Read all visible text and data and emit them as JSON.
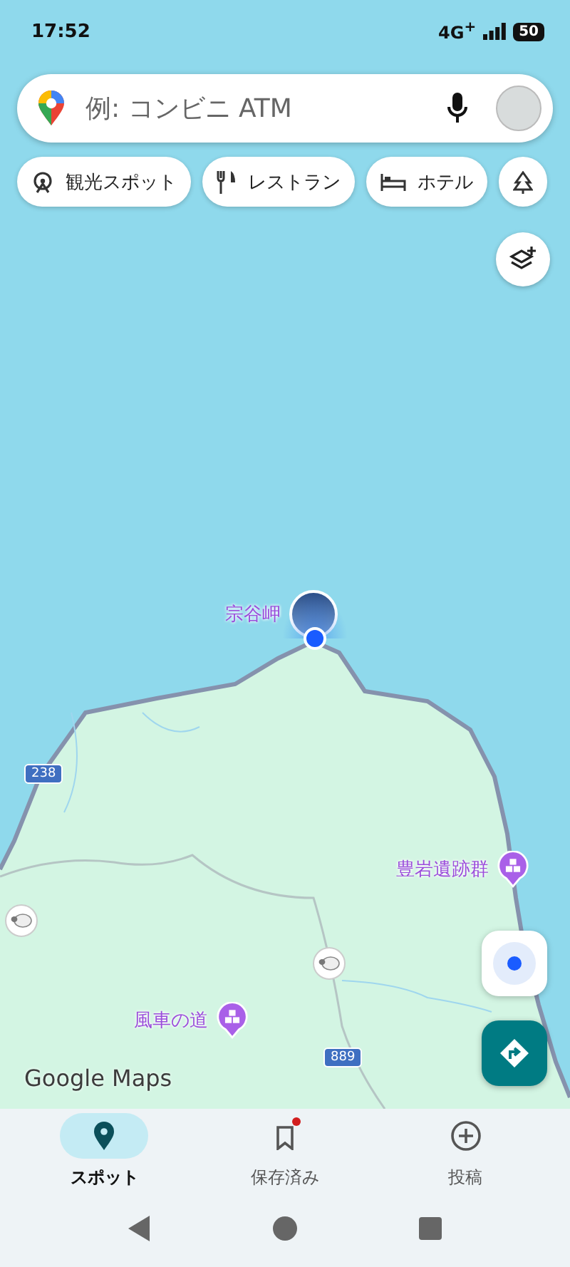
{
  "status_bar": {
    "time": "17:52",
    "network": "4G$^{+}$",
    "battery": "50"
  },
  "search": {
    "placeholder": "例: コンビニ ATM"
  },
  "chips": [
    "観光スポット",
    "レストラン",
    "ホテル"
  ],
  "map": {
    "places": [
      {
        "kind": "photo",
        "label": "宗谷岬"
      },
      {
        "kind": "landmark",
        "label": "豊岩遺跡群"
      },
      {
        "kind": "landmark",
        "label": "風車の道"
      },
      {
        "kind": "sheep"
      },
      {
        "kind": "sheep"
      }
    ],
    "routes": [
      "238",
      "889"
    ],
    "logo": "Google Maps"
  },
  "nav": [
    {
      "label": "スポット",
      "selected": true,
      "dot": false
    },
    {
      "label": "保存済み",
      "selected": false,
      "dot": true
    },
    {
      "label": "投稿",
      "selected": false,
      "dot": false
    }
  ]
}
